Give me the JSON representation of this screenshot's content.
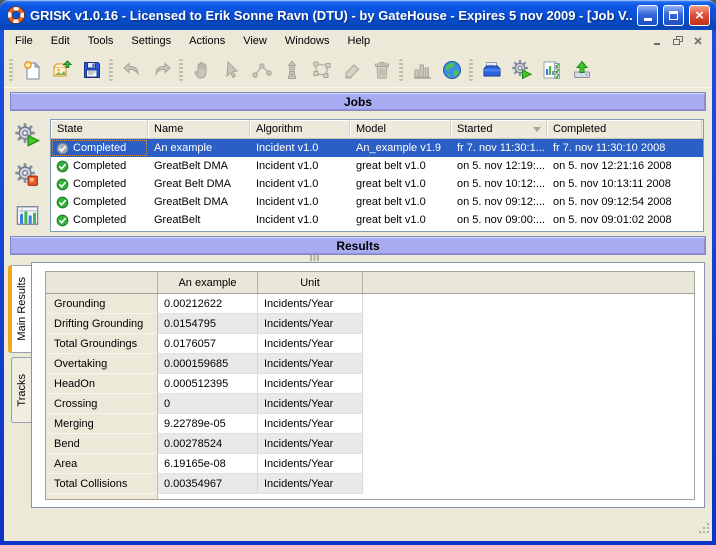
{
  "window": {
    "title": "GRISK v1.0.16 - Licensed to Erik Sonne Ravn (DTU) - by GateHouse - Expires 5 nov 2009 - [Job V...",
    "controls": [
      "minimize",
      "maximize",
      "close"
    ],
    "mdi_controls": [
      "minimize",
      "restore",
      "close"
    ]
  },
  "menubar": {
    "items": [
      "File",
      "Edit",
      "Tools",
      "Settings",
      "Actions",
      "View",
      "Windows",
      "Help"
    ]
  },
  "toolbar": {
    "groups": [
      {
        "buttons": [
          {
            "name": "new-job",
            "icon": "new-document",
            "enabled": true
          },
          {
            "name": "open",
            "icon": "open-folder",
            "enabled": true
          },
          {
            "name": "save",
            "icon": "save",
            "enabled": true
          }
        ]
      },
      {
        "buttons": [
          {
            "name": "undo",
            "icon": "undo",
            "enabled": false
          },
          {
            "name": "redo",
            "icon": "redo",
            "enabled": false
          }
        ]
      },
      {
        "buttons": [
          {
            "name": "pan",
            "icon": "pan-hand",
            "enabled": false
          },
          {
            "name": "select",
            "icon": "select-cursor",
            "enabled": false
          },
          {
            "name": "route",
            "icon": "route-tool",
            "enabled": false
          },
          {
            "name": "leg",
            "icon": "leg-tool",
            "enabled": false
          },
          {
            "name": "polygon",
            "icon": "polygon-tool",
            "enabled": false
          },
          {
            "name": "edit",
            "icon": "edit-tool",
            "enabled": false
          },
          {
            "name": "delete",
            "icon": "delete-trash",
            "enabled": false
          }
        ]
      },
      {
        "buttons": [
          {
            "name": "chart",
            "icon": "chart-tool",
            "enabled": false
          },
          {
            "name": "world-map",
            "icon": "world-map",
            "enabled": true
          }
        ]
      },
      {
        "buttons": [
          {
            "name": "job-box",
            "icon": "job-box",
            "enabled": true
          },
          {
            "name": "run-job",
            "icon": "run-job",
            "enabled": true
          },
          {
            "name": "job-results",
            "icon": "job-results",
            "enabled": true
          },
          {
            "name": "export-job",
            "icon": "export-job",
            "enabled": true
          }
        ]
      }
    ]
  },
  "sidebar": {
    "buttons": [
      {
        "name": "run-job",
        "icon": "run-job"
      },
      {
        "name": "stop-job",
        "icon": "stop-job"
      },
      {
        "name": "show-statistics",
        "icon": "results-stats"
      }
    ]
  },
  "sections": {
    "jobs_title": "Jobs",
    "results_title": "Results"
  },
  "jobs": {
    "columns": [
      "State",
      "Name",
      "Algorithm",
      "Model",
      "Started",
      "Completed"
    ],
    "sorted_column": "Started",
    "partial_row": true,
    "rows": [
      {
        "state": "Completed",
        "name": "An example",
        "algorithm": "Incident v1.0",
        "model": "An_example v1.9",
        "started": "fr 7. nov 11:30:1...",
        "completed": "fr 7. nov 11:30:10 2008",
        "selected": true
      },
      {
        "state": "Completed",
        "name": "GreatBelt DMA",
        "algorithm": "Incident v1.0",
        "model": "great belt v1.0",
        "started": "on 5. nov 12:19:...",
        "completed": "on 5. nov 12:21:16 2008",
        "selected": false
      },
      {
        "state": "Completed",
        "name": "Great Belt DMA",
        "algorithm": "Incident v1.0",
        "model": "great belt v1.0",
        "started": "on 5. nov 10:12:...",
        "completed": "on 5. nov 10:13:11 2008",
        "selected": false
      },
      {
        "state": "Completed",
        "name": "GreatBelt DMA",
        "algorithm": "Incident v1.0",
        "model": "great belt v1.0",
        "started": "on 5. nov 09:12:...",
        "completed": "on 5. nov 09:12:54 2008",
        "selected": false
      },
      {
        "state": "Completed",
        "name": "GreatBelt",
        "algorithm": "Incident v1.0",
        "model": "great belt v1.0",
        "started": "on 5. nov 09:00:...",
        "completed": "on 5. nov 09:01:02 2008",
        "selected": false
      }
    ]
  },
  "results": {
    "tabs": [
      {
        "label": "Main Results",
        "active": true
      },
      {
        "label": "Tracks",
        "active": false
      }
    ],
    "columns": [
      "",
      "An example",
      "Unit"
    ],
    "rows": [
      {
        "label": "Grounding",
        "value": "0.00212622",
        "unit": "Incidents/Year"
      },
      {
        "label": "Drifting Grounding",
        "value": "0.0154795",
        "unit": "Incidents/Year"
      },
      {
        "label": "Total Groundings",
        "value": "0.0176057",
        "unit": "Incidents/Year"
      },
      {
        "label": "Overtaking",
        "value": "0.000159685",
        "unit": "Incidents/Year"
      },
      {
        "label": "HeadOn",
        "value": "0.000512395",
        "unit": "Incidents/Year"
      },
      {
        "label": "Crossing",
        "value": "0",
        "unit": "Incidents/Year"
      },
      {
        "label": "Merging",
        "value": "9.22789e-05",
        "unit": "Incidents/Year"
      },
      {
        "label": "Bend",
        "value": "0.00278524",
        "unit": "Incidents/Year"
      },
      {
        "label": "Area",
        "value": "6.19165e-08",
        "unit": "Incidents/Year"
      },
      {
        "label": "Total Collisions",
        "value": "0.00354967",
        "unit": "Incidents/Year"
      }
    ]
  },
  "colors": {
    "titlebar_blue": "#0a50d6",
    "client_beige": "#ece9d8",
    "section_bar": "#a9abf2",
    "selection_blue": "#2b5fc6",
    "status_green": "#35b03c",
    "tab_accent_orange": "#f2a81d"
  }
}
